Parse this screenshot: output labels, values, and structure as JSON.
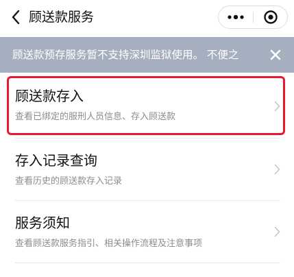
{
  "nav": {
    "title": "顾送款服务"
  },
  "banner": {
    "text": "顾送款预存服务暂不支持深圳监狱使用。 不便之"
  },
  "items": [
    {
      "title": "顾送款存入",
      "desc": "查看已绑定的服刑人员信息、存入顾送款"
    },
    {
      "title": "存入记录查询",
      "desc": "查看历史的顾送款存入记录"
    },
    {
      "title": "服务须知",
      "desc": "查看顾送款服务指引、相关操作流程及注意事项"
    }
  ],
  "colors": {
    "banner_bg": "#a6afbf",
    "highlight": "#e8192c",
    "desc_text": "#8c8c8c"
  }
}
